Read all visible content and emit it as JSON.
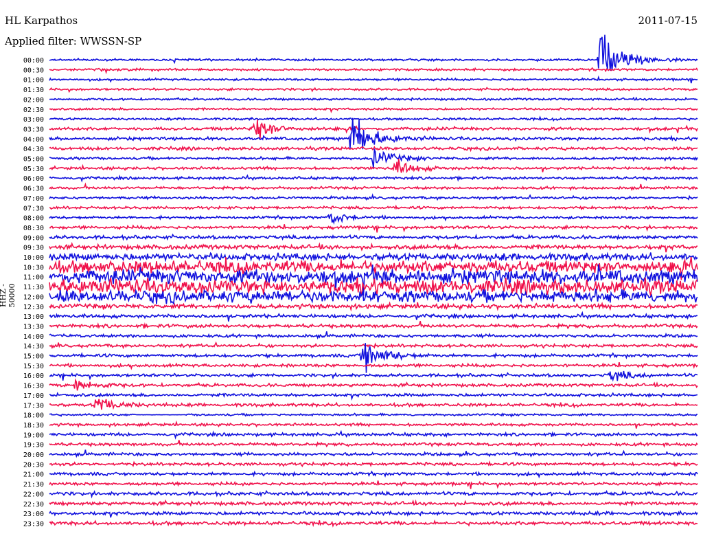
{
  "header": {
    "station": "HL Karpathos",
    "date": "2011-07-15",
    "filter_label": "Applied filter: WWSSN-SP"
  },
  "axis": {
    "ylabel": "HHZ - 50000"
  },
  "chart_data": {
    "type": "line",
    "title": "HL Karpathos",
    "ylabel": "HHZ - 50000",
    "tick_labels": [
      "00:00",
      "00:30",
      "01:00",
      "01:30",
      "02:00",
      "02:30",
      "03:00",
      "03:30",
      "04:00",
      "04:30",
      "05:00",
      "05:30",
      "06:00",
      "06:30",
      "07:00",
      "07:30",
      "08:00",
      "08:30",
      "09:00",
      "09:30",
      "10:00",
      "10:30",
      "11:00",
      "11:30",
      "12:00",
      "12:30",
      "13:00",
      "13:30",
      "14:00",
      "14:30",
      "15:00",
      "15:30",
      "16:00",
      "16:30",
      "17:00",
      "17:30",
      "18:00",
      "18:30",
      "19:00",
      "19:30",
      "20:00",
      "20:30",
      "21:00",
      "21:30",
      "22:00",
      "22:30",
      "23:00",
      "23:30"
    ],
    "series_colors": [
      "#1010dd",
      "#f0104a"
    ],
    "row_amplitude": [
      2.5,
      2.5,
      2.5,
      2.5,
      2.5,
      2.5,
      2.5,
      3.5,
      3.5,
      3.5,
      3,
      3,
      3,
      3,
      3,
      3,
      3,
      3.5,
      4,
      5,
      8,
      14,
      16,
      16,
      14,
      5,
      4,
      4,
      3.5,
      3.5,
      3.5,
      3.5,
      3.5,
      3.5,
      3.5,
      3.5,
      2.5,
      3,
      3.5,
      3.5,
      3.5,
      3.5,
      3.5,
      3.5,
      4,
      4,
      4,
      4
    ],
    "events": [
      {
        "time": "00:00",
        "minute": 25.5,
        "peak": 90
      },
      {
        "time": "04:00",
        "minute": 14,
        "peak": 60
      },
      {
        "time": "05:00",
        "minute": 15,
        "peak": 25
      },
      {
        "time": "03:30",
        "minute": 9.5,
        "peak": 30
      },
      {
        "time": "05:30",
        "minute": 16,
        "peak": 20
      },
      {
        "time": "08:00",
        "minute": 13,
        "peak": 15
      },
      {
        "time": "15:00",
        "minute": 14.5,
        "peak": 50
      },
      {
        "time": "16:30",
        "minute": 1.2,
        "peak": 20
      },
      {
        "time": "17:30",
        "minute": 2.2,
        "peak": 22
      },
      {
        "time": "16:00",
        "minute": 26,
        "peak": 14
      }
    ],
    "gaps": [
      {
        "time": "18:00",
        "from_minute": 4.0,
        "to_minute": 6.3
      }
    ]
  }
}
